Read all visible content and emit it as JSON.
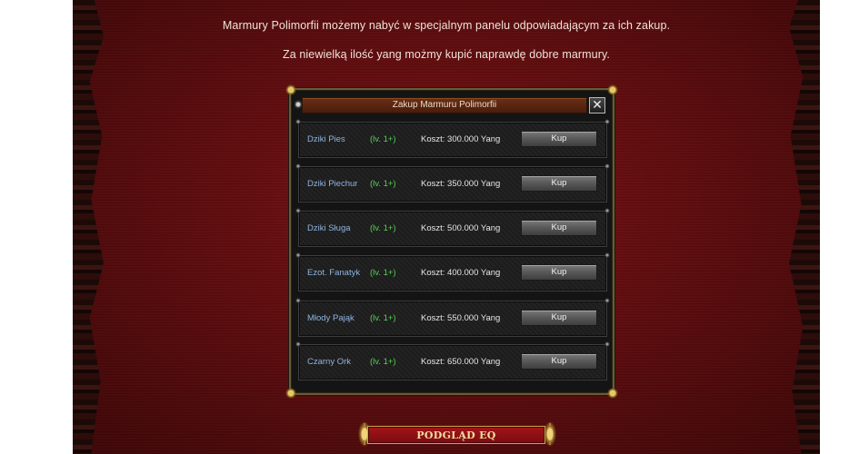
{
  "intro": {
    "line1": "Marmury Polimorfii możemy nabyć w specjalnym panelu odpowiadającym za ich zakup.",
    "line2": "Za niewielką ilość yang możmy kupić naprawdę dobre marmury."
  },
  "window": {
    "title": "Zakup Marmuru Polimorfii",
    "close_glyph": "✕",
    "rows": [
      {
        "name": "Dziki Pies",
        "level": "(lv. 1+)",
        "cost": "Koszt: 300.000 Yang",
        "button": "Kup"
      },
      {
        "name": "Dziki Piechur",
        "level": "(lv. 1+)",
        "cost": "Koszt: 350.000 Yang",
        "button": "Kup"
      },
      {
        "name": "Dziki Sługa",
        "level": "(lv. 1+)",
        "cost": "Koszt: 500.000 Yang",
        "button": "Kup"
      },
      {
        "name": "Ezot. Fanatyk",
        "level": "(lv. 1+)",
        "cost": "Koszt: 400.000 Yang",
        "button": "Kup"
      },
      {
        "name": "Młody Pająk",
        "level": "(lv. 1+)",
        "cost": "Koszt: 550.000 Yang",
        "button": "Kup"
      },
      {
        "name": "Czarny Ork",
        "level": "(lv. 1+)",
        "cost": "Koszt: 650.000 Yang",
        "button": "Kup"
      }
    ]
  },
  "banner": {
    "label": "PODGLĄD EQ"
  },
  "colors": {
    "page_background": "#5e0c0e",
    "mob_name": "#8fb4e0",
    "level_text": "#57d056",
    "banner_background": "#a3151a"
  }
}
